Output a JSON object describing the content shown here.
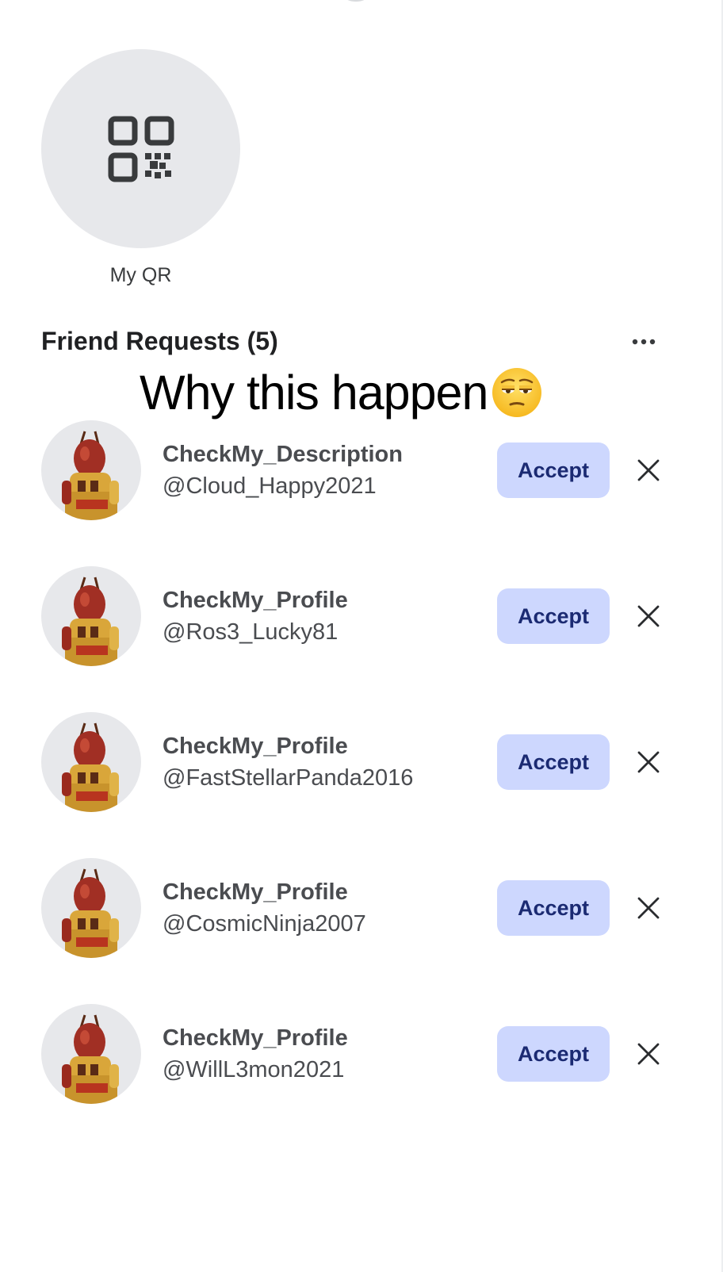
{
  "qr": {
    "label": "My QR",
    "icon": "qr-code-icon"
  },
  "friend_requests": {
    "title": "Friend Requests (5)",
    "more_icon": "more-horizontal-icon",
    "items": [
      {
        "display_name": "CheckMy_Description",
        "username": "@Cloud_Happy2021",
        "accept_label": "Accept",
        "decline_icon": "close-icon"
      },
      {
        "display_name": "CheckMy_Profile",
        "username": "@Ros3_Lucky81",
        "accept_label": "Accept",
        "decline_icon": "close-icon"
      },
      {
        "display_name": "CheckMy_Profile",
        "username": "@FastStellarPanda2016",
        "accept_label": "Accept",
        "decline_icon": "close-icon"
      },
      {
        "display_name": "CheckMy_Profile",
        "username": "@CosmicNinja2007",
        "accept_label": "Accept",
        "decline_icon": "close-icon"
      },
      {
        "display_name": "CheckMy_Profile",
        "username": "@WillL3mon2021",
        "accept_label": "Accept",
        "decline_icon": "close-icon"
      }
    ]
  },
  "overlay": {
    "caption": "Why this happen",
    "emoji": "😌"
  },
  "colors": {
    "accept_bg": "#cdd7fe",
    "accept_text": "#1b2a72",
    "avatar_bg": "#e7e8eb",
    "text_primary": "#202123"
  }
}
